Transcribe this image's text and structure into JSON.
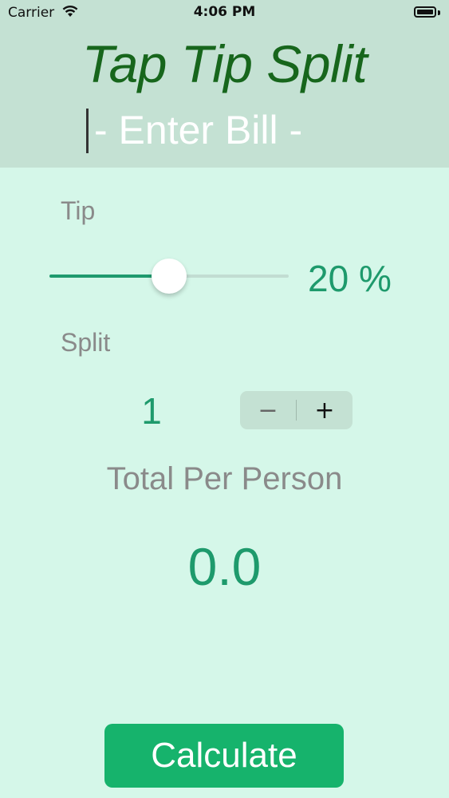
{
  "status_bar": {
    "carrier": "Carrier",
    "time": "4:06 PM",
    "wifi_icon": "wifi-icon",
    "battery_icon": "battery-icon"
  },
  "header": {
    "title": "Tap Tip Split",
    "bill_placeholder": "- Enter Bill -",
    "bill_value": ""
  },
  "tip": {
    "label": "Tip",
    "value_text": "20 %",
    "slider_value": 0.5
  },
  "split": {
    "label": "Split",
    "value": "1",
    "minus_label": "−",
    "plus_label": "+"
  },
  "total": {
    "label": "Total Per Person",
    "value": "0.0"
  },
  "actions": {
    "calculate_label": "Calculate"
  },
  "colors": {
    "background": "#d5f7e9",
    "header_background": "#c4e1d3",
    "title_color": "#17661c",
    "accent": "#1e9a6c",
    "button": "#16b36c",
    "label_gray": "#8a8a8a"
  }
}
